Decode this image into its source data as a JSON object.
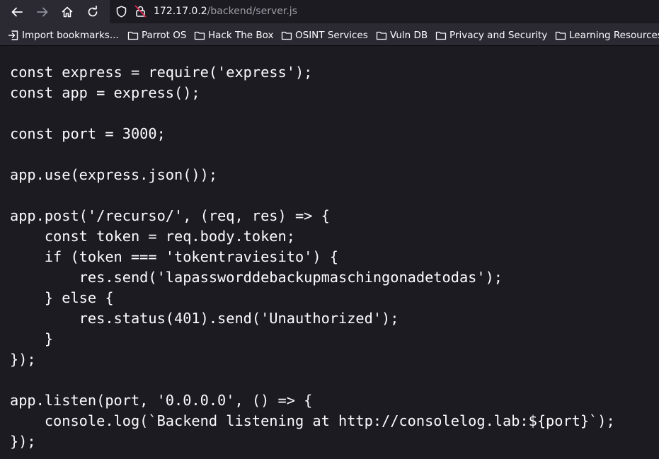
{
  "toolbar": {
    "back_icon": "arrow-left-icon",
    "forward_icon": "arrow-right-icon",
    "home_icon": "home-icon",
    "reload_icon": "reload-icon"
  },
  "urlbar": {
    "host": "172.17.0.2",
    "path": "/backend/server.js",
    "tracking_icon": "shield-icon",
    "security_icon": "insecure-lock-icon"
  },
  "bookmarks": {
    "items": [
      {
        "label": "Import bookmarks...",
        "icon": "import-icon"
      },
      {
        "label": "Parrot OS",
        "icon": "folder-icon"
      },
      {
        "label": "Hack The Box",
        "icon": "folder-icon"
      },
      {
        "label": "OSINT Services",
        "icon": "folder-icon"
      },
      {
        "label": "Vuln DB",
        "icon": "folder-icon"
      },
      {
        "label": "Privacy and Security",
        "icon": "folder-icon"
      },
      {
        "label": "Learning Resources",
        "icon": "folder-icon"
      }
    ]
  },
  "code": {
    "lines": [
      "const express = require('express');",
      "const app = express();",
      "",
      "const port = 3000;",
      "",
      "app.use(express.json());",
      "",
      "app.post('/recurso/', (req, res) => {",
      "    const token = req.body.token;",
      "    if (token === 'tokentraviesito') {",
      "        res.send('lapassworddebackupmaschingonadetodas');",
      "    } else {",
      "        res.status(401).send('Unauthorized');",
      "    }",
      "});",
      "",
      "app.listen(port, '0.0.0.0', () => {",
      "    console.log(`Backend listening at http://consolelog.lab:${port}`);",
      "});"
    ]
  },
  "colors": {
    "toolbar_bg": "#2b2a33",
    "page_bg": "#1c1b22",
    "text": "#fbfbfe",
    "url_path": "#9e9ea6",
    "insecure_accent": "#e22850"
  }
}
